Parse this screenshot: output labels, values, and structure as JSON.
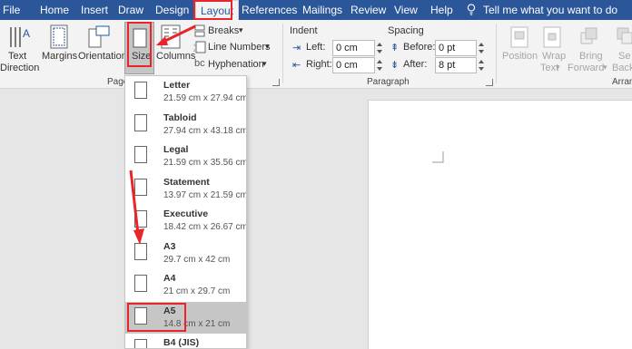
{
  "tabs": [
    "File",
    "Home",
    "Insert",
    "Draw",
    "Design",
    "Layout",
    "References",
    "Mailings",
    "Review",
    "View",
    "Help"
  ],
  "active_tab": "Layout",
  "tell_me": "Tell me what you want to do",
  "ribbon": {
    "text_direction": [
      "Text",
      "Direction"
    ],
    "margins": "Margins",
    "orientation": "Orientation",
    "size": "Size",
    "columns": "Columns",
    "breaks": "Breaks",
    "line_numbers": "Line Numbers",
    "hyphenation": "Hyphenation",
    "page_setup_group": "Page",
    "indent_header": "Indent",
    "spacing_header": "Spacing",
    "left_label": "Left:",
    "right_label": "Right:",
    "left_value": "0 cm",
    "right_value": "0 cm",
    "before_label": "Before:",
    "after_label": "After:",
    "before_value": "0 pt",
    "after_value": "8 pt",
    "paragraph_group": "Paragraph",
    "position": "Position",
    "wrap_text": [
      "Wrap",
      "Text"
    ],
    "bring_forward": [
      "Bring",
      "Forward"
    ],
    "send_backward": [
      "Se",
      "Backw"
    ],
    "arrange_group": "Arran"
  },
  "size_menu": [
    {
      "name": "Letter",
      "dims": "21.59 cm x 27.94 cm"
    },
    {
      "name": "Tabloid",
      "dims": "27.94 cm x 43.18 cm"
    },
    {
      "name": "Legal",
      "dims": "21.59 cm x 35.56 cm"
    },
    {
      "name": "Statement",
      "dims": "13.97 cm x 21.59 cm"
    },
    {
      "name": "Executive",
      "dims": "18.42 cm x 26.67 cm"
    },
    {
      "name": "A3",
      "dims": "29.7 cm x 42 cm"
    },
    {
      "name": "A4",
      "dims": "21 cm x 29.7 cm"
    },
    {
      "name": "A5",
      "dims": "14.8 cm x 21 cm"
    },
    {
      "name": "B4 (JIS)",
      "dims": ""
    }
  ],
  "selected_size": "A5",
  "colors": {
    "brand": "#2b579a",
    "annotation": "#e8252b",
    "selected_bg": "#c6c6c6"
  }
}
